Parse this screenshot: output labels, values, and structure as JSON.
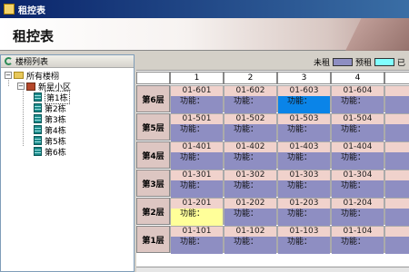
{
  "window": {
    "title": "租控表"
  },
  "banner": {
    "title": "租控表"
  },
  "left_panel": {
    "header": "楼栩列表",
    "tree": {
      "root": "所有楼栩",
      "community": "新星小区",
      "buildings": [
        "第1栋",
        "第2栋",
        "第3栋",
        "第4栋",
        "第5栋",
        "第6栋"
      ],
      "selected_index": 0
    }
  },
  "legend": {
    "unrented": "未租",
    "reserved": "预租",
    "unrented_color": "#8e8ec2",
    "reserved_color": "#80ffff",
    "truncated": "已"
  },
  "grid": {
    "columns": [
      "1",
      "2",
      "3",
      "4"
    ],
    "floors": [
      {
        "label": "第6层",
        "rooms": [
          "01-601",
          "01-602",
          "01-603",
          "01-604"
        ],
        "states": [
          "",
          "",
          "blue",
          ""
        ]
      },
      {
        "label": "第5层",
        "rooms": [
          "01-501",
          "01-502",
          "01-503",
          "01-504"
        ],
        "states": [
          "",
          "",
          "",
          ""
        ]
      },
      {
        "label": "第4层",
        "rooms": [
          "01-401",
          "01-402",
          "01-403",
          "01-404"
        ],
        "states": [
          "",
          "",
          "",
          ""
        ]
      },
      {
        "label": "第3层",
        "rooms": [
          "01-301",
          "01-302",
          "01-303",
          "01-304"
        ],
        "states": [
          "",
          "",
          "",
          ""
        ]
      },
      {
        "label": "第2层",
        "rooms": [
          "01-201",
          "01-202",
          "01-203",
          "01-204"
        ],
        "states": [
          "yellow",
          "",
          "",
          ""
        ]
      },
      {
        "label": "第1层",
        "rooms": [
          "01-101",
          "01-102",
          "01-103",
          "01-104"
        ],
        "states": [
          "",
          "",
          "",
          ""
        ]
      }
    ],
    "func_label": "功能："
  }
}
